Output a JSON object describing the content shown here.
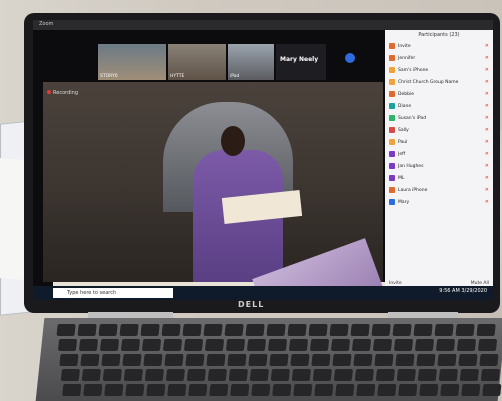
{
  "window": {
    "title": "Zoom"
  },
  "gallery": {
    "tiles": [
      {
        "name": "STORY0"
      },
      {
        "name": "HYTTE"
      },
      {
        "name": "iPad"
      },
      {
        "name": ""
      }
    ],
    "active_speaker_name": "Mary Neely"
  },
  "recording_label": "Recording",
  "participants_panel": {
    "title": "Participants (23)",
    "items": [
      {
        "name": "Invite",
        "color": "#e26a2c"
      },
      {
        "name": "Jennifer",
        "color": "#e26a2c"
      },
      {
        "name": "Sam's iPhone",
        "color": "#f1a33a"
      },
      {
        "name": "Christ Church Group Name",
        "color": "#f1a33a"
      },
      {
        "name": "Debbie",
        "color": "#e26a2c"
      },
      {
        "name": "Diane",
        "color": "#1aa39a"
      },
      {
        "name": "Susan's iPad",
        "color": "#2db56b"
      },
      {
        "name": "Sally",
        "color": "#d64a4a"
      },
      {
        "name": "Paul",
        "color": "#f1a33a"
      },
      {
        "name": "Jeff",
        "color": "#7a3ac6"
      },
      {
        "name": "Jan Hughes",
        "color": "#7a3ac6"
      },
      {
        "name": "ML",
        "color": "#7a3ac6"
      },
      {
        "name": "Laura iPhone",
        "color": "#e26a2c"
      },
      {
        "name": "Mary",
        "color": "#2d6cdf"
      }
    ],
    "footer_left": "Invite",
    "footer_right": "Mute All"
  },
  "taskbar": {
    "search_placeholder": "Type here to search",
    "time": "9:56 AM",
    "date": "3/29/2020"
  },
  "brand": "DELL"
}
